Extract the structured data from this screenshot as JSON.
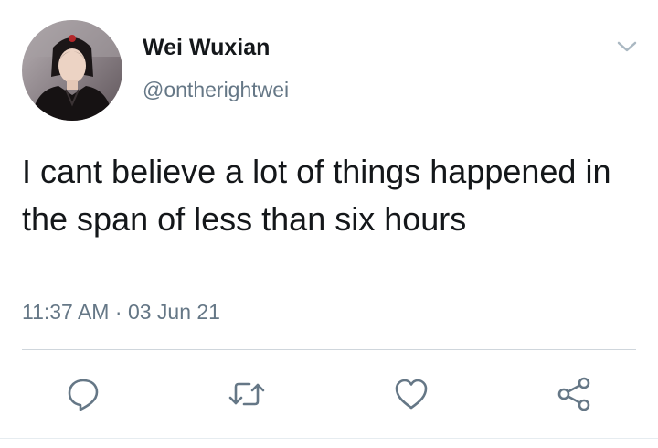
{
  "tweet": {
    "display_name": "Wei Wuxian",
    "handle": "@ontherightwei",
    "text": "I cant believe a lot of things happened in the span of less than six hours",
    "time": "11:37 AM",
    "separator": "·",
    "date": "03 Jun 21"
  },
  "icons": {
    "menu": "chevron-down-icon",
    "reply": "reply-icon",
    "retweet": "retweet-icon",
    "like": "heart-icon",
    "share": "share-icon"
  },
  "colors": {
    "text_primary": "#14171a",
    "text_secondary": "#657786",
    "icon": "#657786",
    "divider": "#cfd6dc"
  }
}
